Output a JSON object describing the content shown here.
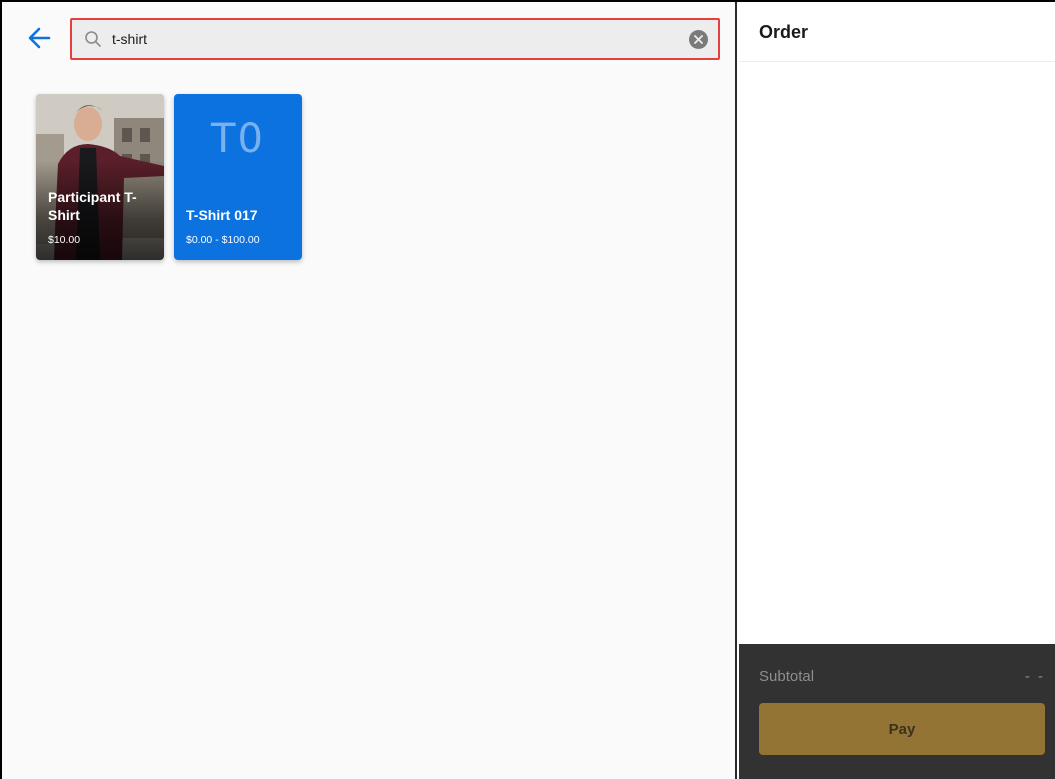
{
  "search": {
    "value": "t-shirt",
    "placeholder": "Search"
  },
  "products": [
    {
      "name": "Participant T-Shirt",
      "price": "$10.00",
      "has_photo": true
    },
    {
      "name": "T-Shirt 017",
      "initials": "T0",
      "price": "$0.00 - $100.00",
      "color": "#0b72e0"
    }
  ],
  "order": {
    "title": "Order",
    "subtotal_label": "Subtotal",
    "subtotal_value": "- -",
    "pay_label": "Pay"
  },
  "colors": {
    "accent": "#0b72e0",
    "search_border": "#e4413e",
    "pay_button": "#937434",
    "footer_bg": "#323232"
  }
}
